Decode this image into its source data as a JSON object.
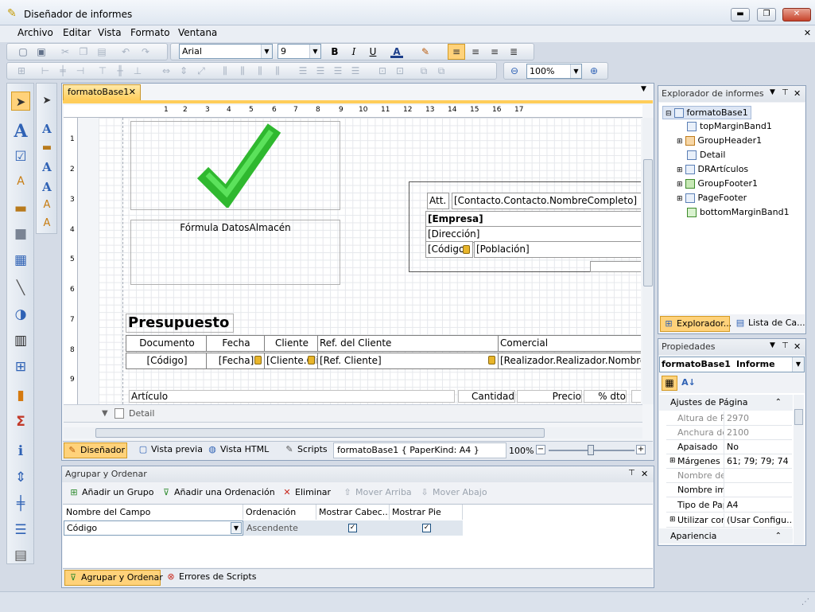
{
  "window": {
    "title": "Diseñador de informes",
    "minimize": "▬",
    "maximize": "❐",
    "close": "✕"
  },
  "menu": [
    "Archivo",
    "Editar",
    "Vista",
    "Formato",
    "Ventana"
  ],
  "toolbar": {
    "font_name": "Arial",
    "font_size": "9",
    "zoom": "100%",
    "bold": "B",
    "italic": "I",
    "underline": "U",
    "fontcolor": "A"
  },
  "doc_tab": {
    "label": "formatoBase1",
    "close": "✕"
  },
  "ruler_h": [
    "1",
    "2",
    "3",
    "4",
    "5",
    "6",
    "7",
    "8",
    "9",
    "10",
    "11",
    "12",
    "13",
    "14",
    "15",
    "16",
    "17"
  ],
  "ruler_v": [
    "1",
    "2",
    "3",
    "4",
    "5",
    "6",
    "7",
    "8",
    "9"
  ],
  "report": {
    "formula": "Fórmula DatosAlmacén",
    "att": "Att.",
    "contacto": "[Contacto.Contacto.NombreCompleto]",
    "empresa": "[Empresa]",
    "direccion": "[Dirección]",
    "codigo_postal": "[Código",
    "poblacion": "[Población]",
    "trailing": "[C",
    "presupuesto": "Presupuesto",
    "headers": [
      "Documento",
      "Fecha",
      "Cliente",
      "Ref. del Cliente",
      "Comercial"
    ],
    "values": [
      "[Código]",
      "[Fecha]",
      "[Cliente.Cli",
      "[Ref. Cliente]",
      "[Realizador.Realizador.NombreC"
    ],
    "detail_headers": [
      "Artículo",
      "Cantidad",
      "Precio",
      "% dto"
    ],
    "band_detail": "Detail"
  },
  "bottom_tabs": {
    "designer": "Diseñador",
    "preview": "Vista previa",
    "html": "Vista HTML",
    "scripts": "Scripts",
    "status": "formatoBase1 { PaperKind: A4 }",
    "zoom": "100%"
  },
  "explorer": {
    "title": "Explorador de informes",
    "items": [
      "formatoBase1",
      "topMarginBand1",
      "GroupHeader1",
      "Detail",
      "DRArtículos",
      "GroupFooter1",
      "PageFooter",
      "bottomMarginBand1"
    ],
    "tab1": "Explorador...",
    "tab2": "Lista de Ca..."
  },
  "properties": {
    "title": "Propiedades",
    "object": "formatoBase1",
    "object_type": "Informe",
    "category1": "Ajustes de Página",
    "rows": [
      {
        "name": "Altura de Pá",
        "value": "2970"
      },
      {
        "name": "Anchura de",
        "value": "2100"
      },
      {
        "name": "Apaisado",
        "value": "No"
      },
      {
        "name": "Márgenes",
        "value": "61; 79; 79; 74"
      },
      {
        "name": "Nombre del",
        "value": ""
      },
      {
        "name": "Nombre imp",
        "value": ""
      },
      {
        "name": "Tipo de Pap",
        "value": "A4"
      },
      {
        "name": "Utilizar conf",
        "value": "(Usar Configu..."
      }
    ],
    "category2": "Apariencia"
  },
  "group_panel": {
    "title": "Agrupar y Ordenar",
    "add_group": "Añadir un Grupo",
    "add_sort": "Añadir una Ordenación",
    "delete": "Eliminar",
    "move_up": "Mover Arriba",
    "move_down": "Mover Abajo",
    "columns": [
      "Nombre del Campo",
      "Ordenación",
      "Mostrar Cabec...",
      "Mostrar Pie"
    ],
    "row": {
      "field": "Código",
      "sort": "Ascendente"
    },
    "tab1": "Agrupar y Ordenar",
    "tab2": "Errores de Scripts"
  }
}
